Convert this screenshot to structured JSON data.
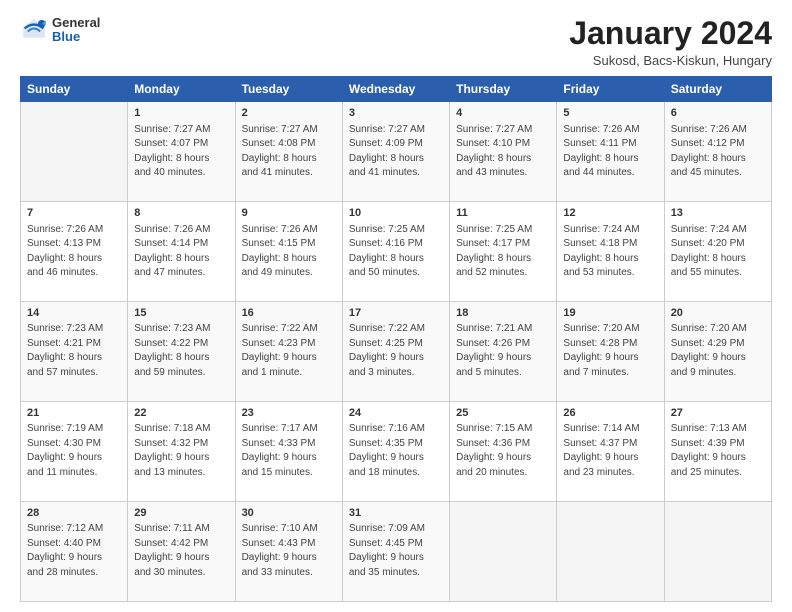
{
  "header": {
    "logo": {
      "general": "General",
      "blue": "Blue"
    },
    "title": "January 2024",
    "subtitle": "Sukosd, Bacs-Kiskun, Hungary"
  },
  "calendar": {
    "weekdays": [
      "Sunday",
      "Monday",
      "Tuesday",
      "Wednesday",
      "Thursday",
      "Friday",
      "Saturday"
    ],
    "rows": [
      [
        {
          "day": "",
          "sunrise": "",
          "sunset": "",
          "daylight": ""
        },
        {
          "day": "1",
          "sunrise": "Sunrise: 7:27 AM",
          "sunset": "Sunset: 4:07 PM",
          "daylight": "Daylight: 8 hours and 40 minutes."
        },
        {
          "day": "2",
          "sunrise": "Sunrise: 7:27 AM",
          "sunset": "Sunset: 4:08 PM",
          "daylight": "Daylight: 8 hours and 41 minutes."
        },
        {
          "day": "3",
          "sunrise": "Sunrise: 7:27 AM",
          "sunset": "Sunset: 4:09 PM",
          "daylight": "Daylight: 8 hours and 41 minutes."
        },
        {
          "day": "4",
          "sunrise": "Sunrise: 7:27 AM",
          "sunset": "Sunset: 4:10 PM",
          "daylight": "Daylight: 8 hours and 43 minutes."
        },
        {
          "day": "5",
          "sunrise": "Sunrise: 7:26 AM",
          "sunset": "Sunset: 4:11 PM",
          "daylight": "Daylight: 8 hours and 44 minutes."
        },
        {
          "day": "6",
          "sunrise": "Sunrise: 7:26 AM",
          "sunset": "Sunset: 4:12 PM",
          "daylight": "Daylight: 8 hours and 45 minutes."
        }
      ],
      [
        {
          "day": "7",
          "sunrise": "Sunrise: 7:26 AM",
          "sunset": "Sunset: 4:13 PM",
          "daylight": "Daylight: 8 hours and 46 minutes."
        },
        {
          "day": "8",
          "sunrise": "Sunrise: 7:26 AM",
          "sunset": "Sunset: 4:14 PM",
          "daylight": "Daylight: 8 hours and 47 minutes."
        },
        {
          "day": "9",
          "sunrise": "Sunrise: 7:26 AM",
          "sunset": "Sunset: 4:15 PM",
          "daylight": "Daylight: 8 hours and 49 minutes."
        },
        {
          "day": "10",
          "sunrise": "Sunrise: 7:25 AM",
          "sunset": "Sunset: 4:16 PM",
          "daylight": "Daylight: 8 hours and 50 minutes."
        },
        {
          "day": "11",
          "sunrise": "Sunrise: 7:25 AM",
          "sunset": "Sunset: 4:17 PM",
          "daylight": "Daylight: 8 hours and 52 minutes."
        },
        {
          "day": "12",
          "sunrise": "Sunrise: 7:24 AM",
          "sunset": "Sunset: 4:18 PM",
          "daylight": "Daylight: 8 hours and 53 minutes."
        },
        {
          "day": "13",
          "sunrise": "Sunrise: 7:24 AM",
          "sunset": "Sunset: 4:20 PM",
          "daylight": "Daylight: 8 hours and 55 minutes."
        }
      ],
      [
        {
          "day": "14",
          "sunrise": "Sunrise: 7:23 AM",
          "sunset": "Sunset: 4:21 PM",
          "daylight": "Daylight: 8 hours and 57 minutes."
        },
        {
          "day": "15",
          "sunrise": "Sunrise: 7:23 AM",
          "sunset": "Sunset: 4:22 PM",
          "daylight": "Daylight: 8 hours and 59 minutes."
        },
        {
          "day": "16",
          "sunrise": "Sunrise: 7:22 AM",
          "sunset": "Sunset: 4:23 PM",
          "daylight": "Daylight: 9 hours and 1 minute."
        },
        {
          "day": "17",
          "sunrise": "Sunrise: 7:22 AM",
          "sunset": "Sunset: 4:25 PM",
          "daylight": "Daylight: 9 hours and 3 minutes."
        },
        {
          "day": "18",
          "sunrise": "Sunrise: 7:21 AM",
          "sunset": "Sunset: 4:26 PM",
          "daylight": "Daylight: 9 hours and 5 minutes."
        },
        {
          "day": "19",
          "sunrise": "Sunrise: 7:20 AM",
          "sunset": "Sunset: 4:28 PM",
          "daylight": "Daylight: 9 hours and 7 minutes."
        },
        {
          "day": "20",
          "sunrise": "Sunrise: 7:20 AM",
          "sunset": "Sunset: 4:29 PM",
          "daylight": "Daylight: 9 hours and 9 minutes."
        }
      ],
      [
        {
          "day": "21",
          "sunrise": "Sunrise: 7:19 AM",
          "sunset": "Sunset: 4:30 PM",
          "daylight": "Daylight: 9 hours and 11 minutes."
        },
        {
          "day": "22",
          "sunrise": "Sunrise: 7:18 AM",
          "sunset": "Sunset: 4:32 PM",
          "daylight": "Daylight: 9 hours and 13 minutes."
        },
        {
          "day": "23",
          "sunrise": "Sunrise: 7:17 AM",
          "sunset": "Sunset: 4:33 PM",
          "daylight": "Daylight: 9 hours and 15 minutes."
        },
        {
          "day": "24",
          "sunrise": "Sunrise: 7:16 AM",
          "sunset": "Sunset: 4:35 PM",
          "daylight": "Daylight: 9 hours and 18 minutes."
        },
        {
          "day": "25",
          "sunrise": "Sunrise: 7:15 AM",
          "sunset": "Sunset: 4:36 PM",
          "daylight": "Daylight: 9 hours and 20 minutes."
        },
        {
          "day": "26",
          "sunrise": "Sunrise: 7:14 AM",
          "sunset": "Sunset: 4:37 PM",
          "daylight": "Daylight: 9 hours and 23 minutes."
        },
        {
          "day": "27",
          "sunrise": "Sunrise: 7:13 AM",
          "sunset": "Sunset: 4:39 PM",
          "daylight": "Daylight: 9 hours and 25 minutes."
        }
      ],
      [
        {
          "day": "28",
          "sunrise": "Sunrise: 7:12 AM",
          "sunset": "Sunset: 4:40 PM",
          "daylight": "Daylight: 9 hours and 28 minutes."
        },
        {
          "day": "29",
          "sunrise": "Sunrise: 7:11 AM",
          "sunset": "Sunset: 4:42 PM",
          "daylight": "Daylight: 9 hours and 30 minutes."
        },
        {
          "day": "30",
          "sunrise": "Sunrise: 7:10 AM",
          "sunset": "Sunset: 4:43 PM",
          "daylight": "Daylight: 9 hours and 33 minutes."
        },
        {
          "day": "31",
          "sunrise": "Sunrise: 7:09 AM",
          "sunset": "Sunset: 4:45 PM",
          "daylight": "Daylight: 9 hours and 35 minutes."
        },
        {
          "day": "",
          "sunrise": "",
          "sunset": "",
          "daylight": ""
        },
        {
          "day": "",
          "sunrise": "",
          "sunset": "",
          "daylight": ""
        },
        {
          "day": "",
          "sunrise": "",
          "sunset": "",
          "daylight": ""
        }
      ]
    ]
  }
}
